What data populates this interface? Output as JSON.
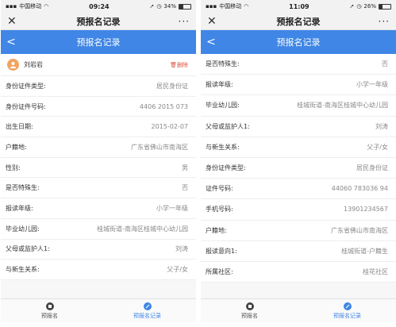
{
  "left": {
    "status": {
      "carrier": "中国移动",
      "time": "09:24",
      "battery": "34%",
      "battery_level": 0.34
    },
    "topbar": {
      "close": "✕",
      "title": "预报名记录",
      "more": "···"
    },
    "bluebar": {
      "back": "<",
      "title": "预报名记录"
    },
    "person": {
      "name": "刘岩岩",
      "delete_label": "删除"
    },
    "rows": [
      {
        "label": "身份证件类型:",
        "value": "居民身份证"
      },
      {
        "label": "身份证件号码:",
        "value": "4406 2015 073"
      },
      {
        "label": "出生日期:",
        "value": "2015-02-07"
      },
      {
        "label": "户籍地:",
        "value": "广东省佛山市南海区"
      },
      {
        "label": "性别:",
        "value": "男"
      },
      {
        "label": "是否特殊生:",
        "value": "否"
      },
      {
        "label": "报读年级:",
        "value": "小学一年级"
      },
      {
        "label": "毕业幼儿园:",
        "value": "桂城街道-南海区桂城中心幼儿园"
      },
      {
        "label": "父母或监护人1:",
        "value": "刘涛"
      },
      {
        "label": "与新生关系:",
        "value": "父子/女"
      }
    ],
    "tabs": [
      {
        "label": "预报名"
      },
      {
        "label": "预报名记录"
      }
    ]
  },
  "right": {
    "status": {
      "carrier": "中国移动",
      "time": "11:09",
      "battery": "26%",
      "battery_level": 0.26
    },
    "topbar": {
      "close": "✕",
      "title": "预报名记录",
      "more": "···"
    },
    "bluebar": {
      "back": "<",
      "title": "预报名记录"
    },
    "rows": [
      {
        "label": "是否特殊生:",
        "value": "否"
      },
      {
        "label": "报读年级:",
        "value": "小学一年级"
      },
      {
        "label": "毕业幼儿园:",
        "value": "桂城街道-南海区桂城中心幼儿园"
      },
      {
        "label": "父母或监护人1:",
        "value": "刘涛"
      },
      {
        "label": "与新生关系:",
        "value": "父子/女"
      },
      {
        "label": "身份证件类型:",
        "value": "居民身份证"
      },
      {
        "label": "证件号码:",
        "value": "44060 783036 94"
      },
      {
        "label": "手机号码:",
        "value": "13901234567"
      },
      {
        "label": "户籍地:",
        "value": "广东省佛山市南海区"
      },
      {
        "label": "报读意向1:",
        "value": "桂城街道-户籍生"
      },
      {
        "label": "所属社区:",
        "value": "桂花社区"
      }
    ],
    "tabs": [
      {
        "label": "预报名"
      },
      {
        "label": "预报名记录"
      }
    ]
  },
  "colors": {
    "accent": "#3f86e6",
    "danger": "#e0513b",
    "avatar": "#f0a461"
  }
}
